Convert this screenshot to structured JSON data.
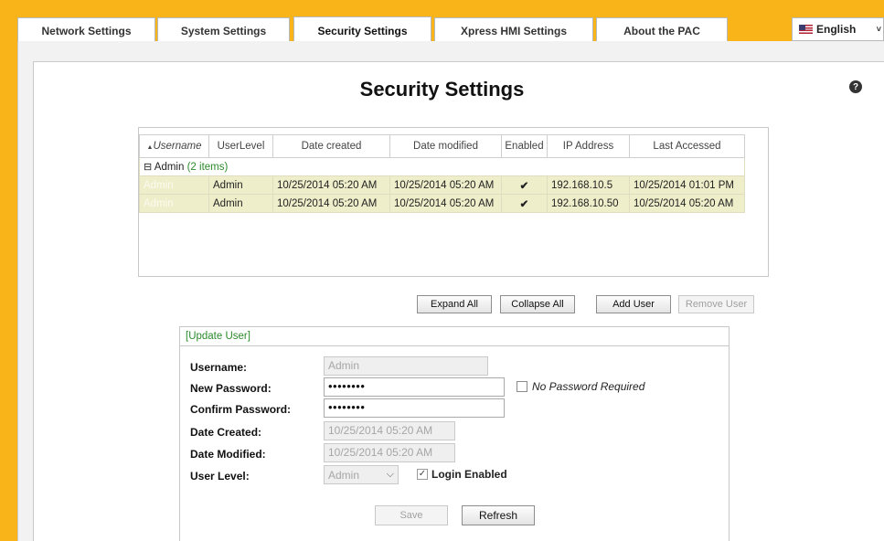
{
  "tabs": [
    {
      "label": "Network Settings"
    },
    {
      "label": "System Settings"
    },
    {
      "label": "Security Settings",
      "active": true
    },
    {
      "label": "Xpress HMI Settings"
    },
    {
      "label": "About the PAC"
    }
  ],
  "language": {
    "label": "English",
    "icon": "us-flag-icon"
  },
  "page": {
    "title": "Security Settings",
    "help_icon": "?"
  },
  "grid": {
    "columns": [
      "Username",
      "UserLevel",
      "Date created",
      "Date modified",
      "Enabled",
      "IP Address",
      "Last Accessed"
    ],
    "sort_indicator": "▲",
    "group": {
      "label": "Admin",
      "count": "(2 items)",
      "toggle": "⊟"
    },
    "rows": [
      {
        "username": "Admin",
        "level": "Admin",
        "created": "10/25/2014 05:20 AM",
        "modified": "10/25/2014 05:20 AM",
        "enabled": "✔",
        "ip": "192.168.10.5",
        "last": "10/25/2014 01:01 PM"
      },
      {
        "username": "Admin",
        "level": "Admin",
        "created": "10/25/2014 05:20 AM",
        "modified": "10/25/2014 05:20 AM",
        "enabled": "✔",
        "ip": "192.168.10.50",
        "last": "10/25/2014 05:20 AM"
      }
    ]
  },
  "buttons": {
    "expand_all": "Expand All",
    "collapse_all": "Collapse All",
    "add_user": "Add User",
    "remove_user": "Remove User",
    "save": "Save",
    "refresh": "Refresh"
  },
  "form": {
    "legend": "[Update User]",
    "username_label": "Username:",
    "username_value": "Admin",
    "new_password_label": "New Password:",
    "new_password_value": "••••••••",
    "no_password_label": "No Password Required",
    "confirm_password_label": "Confirm Password:",
    "confirm_password_value": "••••••••",
    "date_created_label": "Date Created:",
    "date_created_value": "10/25/2014 05:20 AM",
    "date_modified_label": "Date Modified:",
    "date_modified_value": "10/25/2014 05:20 AM",
    "user_level_label": "User Level:",
    "user_level_value": "Admin",
    "login_enabled_label": "Login Enabled",
    "login_enabled_checked": "✓"
  }
}
